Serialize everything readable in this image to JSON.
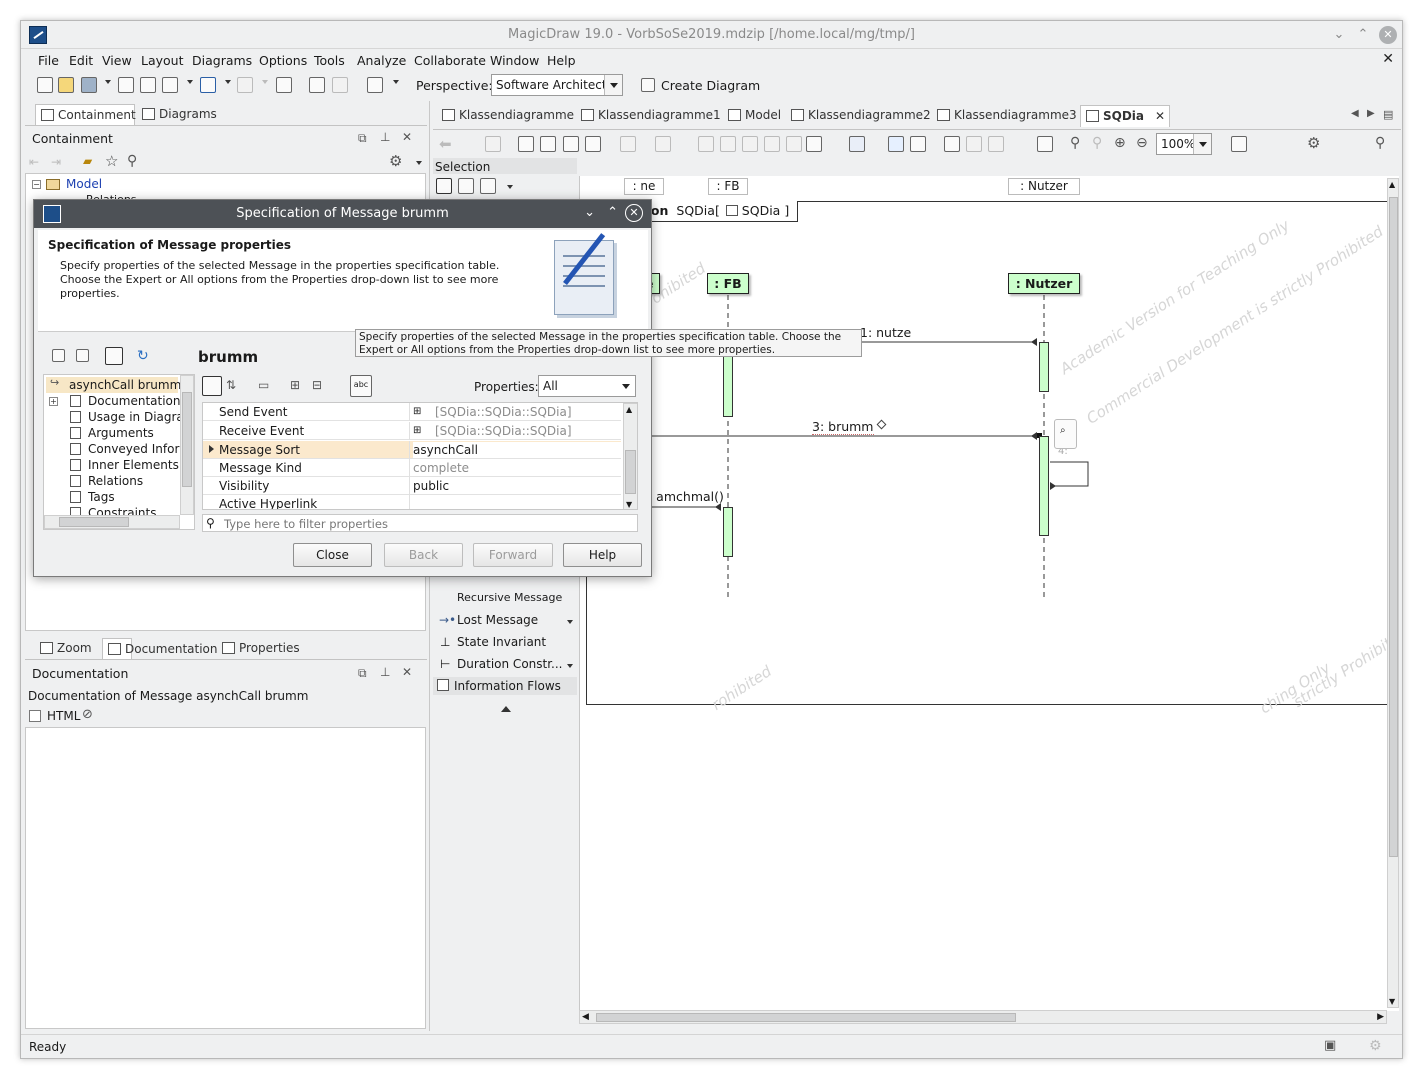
{
  "window": {
    "title": "MagicDraw 19.0 - VorbSoSe2019.mdzip [/home.local/mg/tmp/]"
  },
  "menu": [
    "File",
    "Edit",
    "View",
    "Layout",
    "Diagrams",
    "Options",
    "Tools",
    "Analyze",
    "Collaborate",
    "Window",
    "Help"
  ],
  "toolbar": {
    "perspective_label": "Perspective:",
    "perspective_value": "Software Architect",
    "create_diagram": "Create Diagram"
  },
  "left_panel": {
    "tabs": [
      "Containment",
      "Diagrams"
    ],
    "title": "Containment",
    "tree": {
      "root": "Model",
      "child": "Relations"
    }
  },
  "bottom_panel": {
    "tabs": [
      "Zoom",
      "Documentation",
      "Properties"
    ],
    "title": "Documentation",
    "doc_of": "Documentation of Message asynchCall brumm",
    "html_label": "HTML"
  },
  "status": "Ready",
  "diagram_tabs": [
    "Klassendiagramme",
    "Klassendiagramme1",
    "Model",
    "Klassendiagramme2",
    "Klassendiagramme3",
    "SQDia"
  ],
  "diagram_toolbar": {
    "zoom": "100%"
  },
  "palette": {
    "selection": "Selection",
    "items": [
      "Recursive Message",
      "Lost Message",
      "State Invariant",
      "Duration Constr...",
      "Information Flows"
    ]
  },
  "diagram": {
    "frame_kw": "interaction",
    "frame_name": "SQDia",
    "frame_ref": "SQDia",
    "frame_bracket_open": "[",
    "frame_bracket_close": "]",
    "lifelines_top": [
      ": ne",
      ": FB",
      ": Nutzer"
    ],
    "lifelines": [
      ": FB",
      ": Nutzer"
    ],
    "cut_lifeline": "e",
    "messages": [
      "1: nutze",
      "3: brumm",
      ": amchmal()"
    ],
    "self_msg": "4:",
    "watermark_a": "Academic Version for Teaching Only",
    "watermark_b": "Commercial Development is strictly Prohibited",
    "watermark_c": "rohibited",
    "watermark_d": "ching Only",
    "watermark_e": "strictly Prohibite"
  },
  "dialog": {
    "title": "Specification of Message brumm",
    "header_title": "Specification of Message properties",
    "header_text": "Specify properties of the selected Message in the properties specification table. Choose the Expert or All options from the Properties drop-down list to see more properties.",
    "tooltip": "Specify properties of the selected Message in the properties specification table. Choose the Expert or All options from the Properties drop-down list to see more properties.",
    "element_name": "brumm",
    "nav_items": [
      "asynchCall brumm",
      "Documentation/",
      "Usage in Diagra",
      "Arguments",
      "Conveyed Infor",
      "Inner Elements",
      "Relations",
      "Tags",
      "Constraints"
    ],
    "properties_label": "Properties:",
    "properties_value": "All",
    "rows": [
      {
        "key": "Send Event",
        "value": "[SQDia::SQDia::SQDia]"
      },
      {
        "key": "Receive Event",
        "value": "[SQDia::SQDia::SQDia]"
      },
      {
        "key": "Message Sort",
        "value": "asynchCall"
      },
      {
        "key": "Message Kind",
        "value": "complete"
      },
      {
        "key": "Visibility",
        "value": "public"
      },
      {
        "key": "Active Hyperlink",
        "value": ""
      }
    ],
    "filter_placeholder": "Type here to filter properties",
    "buttons": {
      "close": "Close",
      "back": "Back",
      "forward": "Forward",
      "help": "Help"
    }
  }
}
